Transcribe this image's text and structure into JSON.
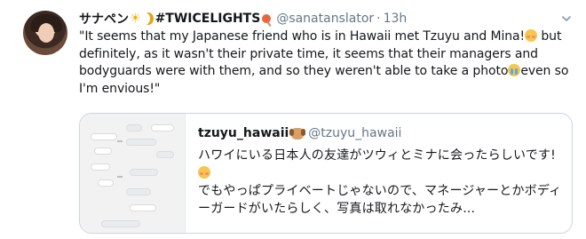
{
  "tweet": {
    "author": {
      "display_name": "サナペン",
      "hashtag": "#TWICELIGHTS",
      "handle": "@sanatanslator",
      "separator": "·",
      "time": "13h"
    },
    "text_line1_a": "\"It seems that my Japanese friend who is in Hawaii met Tzuyu and Mina!",
    "text_line1_b": " but definitely, as it wasn't their private time, it seems that their managers and bodyguards were with them, and so they weren't able to take a photo",
    "text_line1_c": "even so I'm envious!\"",
    "icons": [
      "sun-emoji",
      "moon-emoji",
      "lollipop-emoji",
      "flushed-face-emoji",
      "crying-face-emoji",
      "chevron-down-icon"
    ]
  },
  "quote": {
    "author": {
      "display_name": "tzuyu_hawaii",
      "handle": "@tzuyu_hawaii"
    },
    "text_a": "ハワイにいる日本人の友達がツウィとミナに会ったらしいです!",
    "text_b": "でもやっぱプライベートじゃないので、マネージャーとかボディーガードがいたらしく、写真は取れなかったみ...",
    "icons": [
      "dog-emoji",
      "flushed-face-emoji"
    ]
  },
  "colors": {
    "text": "#14171a",
    "secondary": "#657786",
    "border": "#ccd6dd",
    "background": "#ffffff"
  }
}
